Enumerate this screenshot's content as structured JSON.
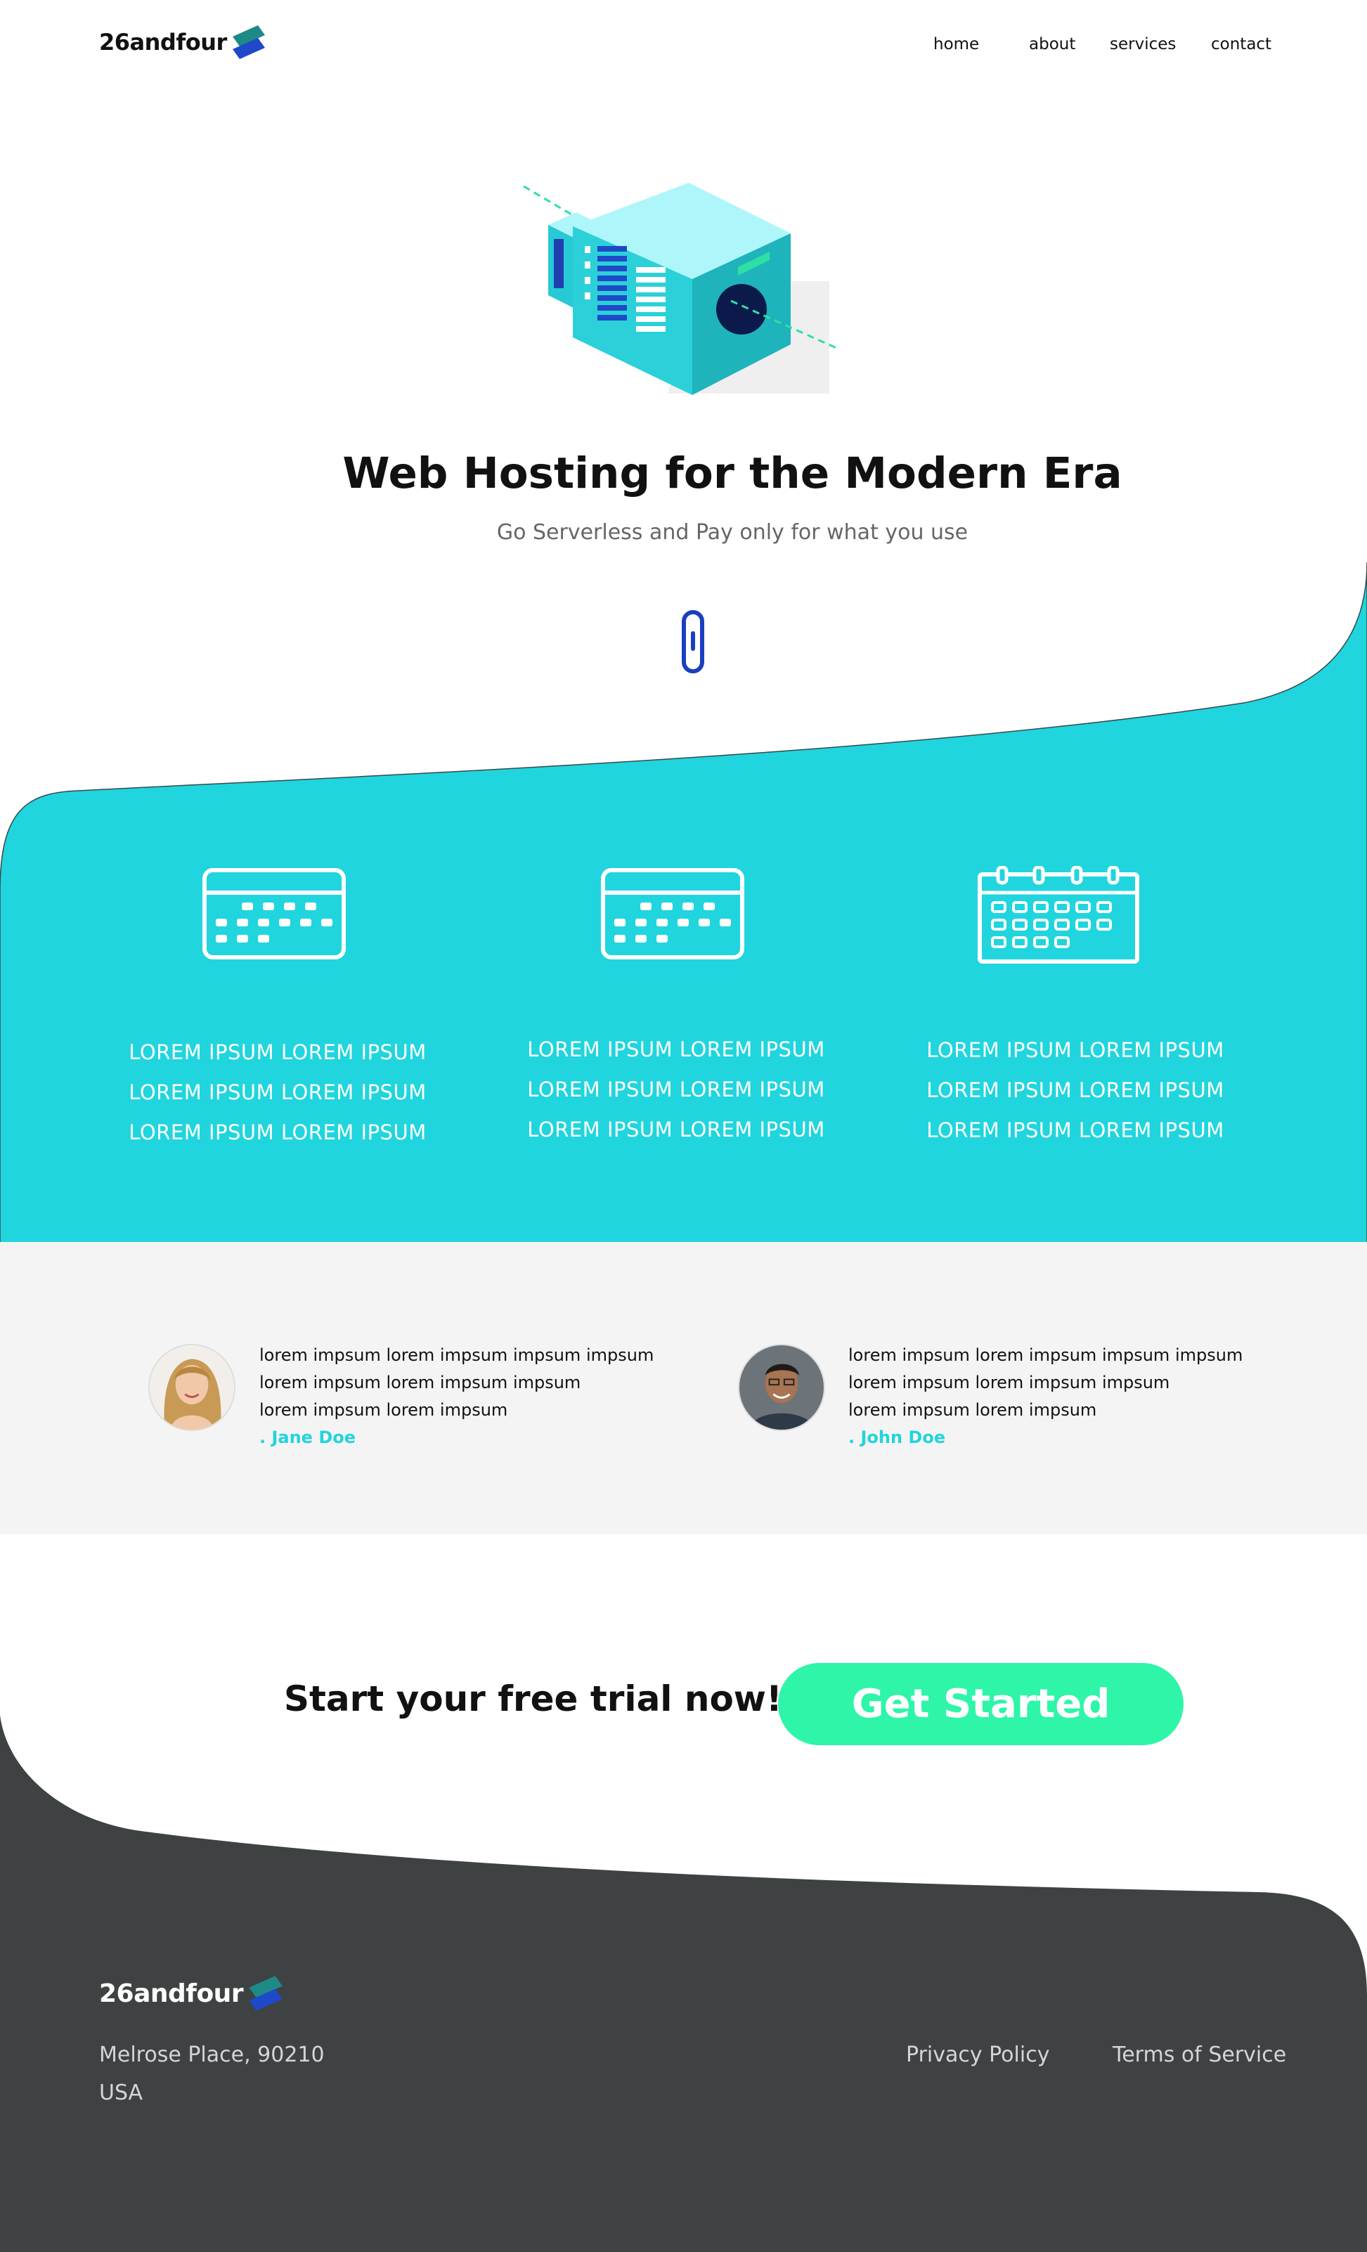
{
  "brand": {
    "name": "26andfour",
    "logo_icon": "stacked-parallelogram-logo",
    "colors": {
      "teal": "#1e8a87",
      "blue": "#1f49c8"
    }
  },
  "nav": {
    "items": [
      "home",
      "about",
      "services",
      "contact"
    ]
  },
  "hero": {
    "title": "Web Hosting for the Modern Era",
    "subtitle": "Go Serverless and Pay only for what you use",
    "illustration": "isometric-server-building",
    "scroll_icon": "scroll-mouse-icon"
  },
  "features": [
    {
      "icon": "keypad-icon",
      "lines": [
        "LOREM IPSUM LOREM IPSUM",
        "LOREM IPSUM LOREM IPSUM",
        "LOREM IPSUM LOREM IPSUM"
      ]
    },
    {
      "icon": "keypad-icon",
      "lines": [
        "LOREM IPSUM LOREM IPSUM",
        "LOREM IPSUM LOREM IPSUM",
        "LOREM IPSUM LOREM IPSUM"
      ]
    },
    {
      "icon": "calendar-icon",
      "lines": [
        "LOREM IPSUM LOREM IPSUM",
        "LOREM IPSUM LOREM IPSUM",
        "LOREM IPSUM LOREM IPSUM"
      ]
    }
  ],
  "testimonials": [
    {
      "lines": [
        "lorem impsum lorem impsum impsum impsum",
        "lorem impsum lorem impsum impsum",
        "lorem impsum lorem impsum"
      ],
      "name": ". Jane Doe"
    },
    {
      "lines": [
        "lorem impsum lorem impsum impsum impsum",
        "lorem impsum lorem impsum impsum",
        "lorem impsum lorem impsum"
      ],
      "name": ". John Doe"
    }
  ],
  "cta": {
    "text": "Start your free trial now!",
    "button": "Get Started"
  },
  "footer": {
    "address_line1": "Melrose Place, 90210",
    "address_line2": "USA",
    "links": [
      "Privacy Policy",
      "Terms of Service"
    ]
  },
  "colors": {
    "teal_section": "#20d5de",
    "footer_bg": "#3e4243",
    "cta_button": "#2ef5a8",
    "accent_name": "#22d4dd",
    "scroll_icon": "#1a3fbf"
  }
}
